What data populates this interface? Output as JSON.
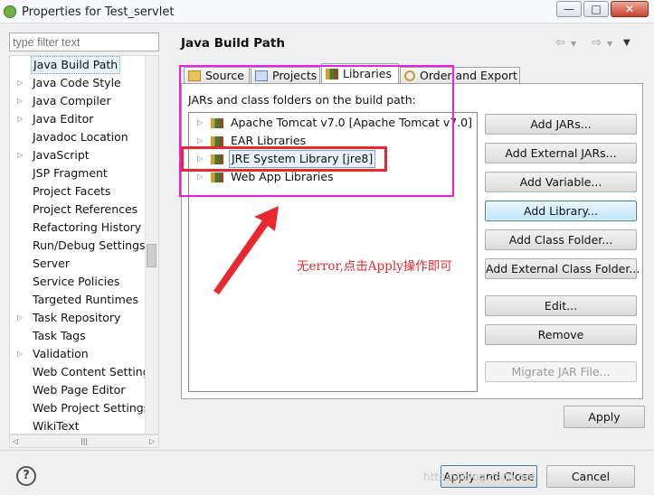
{
  "window": {
    "title": "Properties for Test_servlet",
    "controls": {
      "minimize": "—",
      "maximize": "□",
      "close": "✕"
    }
  },
  "sidebar": {
    "filter_placeholder": "type filter text",
    "items": [
      {
        "label": "Java Build Path",
        "expandable": false,
        "selected": true
      },
      {
        "label": "Java Code Style",
        "expandable": true
      },
      {
        "label": "Java Compiler",
        "expandable": true
      },
      {
        "label": "Java Editor",
        "expandable": true
      },
      {
        "label": "Javadoc Location",
        "expandable": false
      },
      {
        "label": "JavaScript",
        "expandable": true
      },
      {
        "label": "JSP Fragment",
        "expandable": false
      },
      {
        "label": "Project Facets",
        "expandable": false
      },
      {
        "label": "Project References",
        "expandable": false
      },
      {
        "label": "Refactoring History",
        "expandable": false
      },
      {
        "label": "Run/Debug Settings",
        "expandable": false
      },
      {
        "label": "Server",
        "expandable": false
      },
      {
        "label": "Service Policies",
        "expandable": false
      },
      {
        "label": "Targeted Runtimes",
        "expandable": false
      },
      {
        "label": "Task Repository",
        "expandable": true
      },
      {
        "label": "Task Tags",
        "expandable": false
      },
      {
        "label": "Validation",
        "expandable": true
      },
      {
        "label": "Web Content Settings",
        "expandable": false
      },
      {
        "label": "Web Page Editor",
        "expandable": false
      },
      {
        "label": "Web Project Settings",
        "expandable": false
      },
      {
        "label": "WikiText",
        "expandable": false
      }
    ]
  },
  "page": {
    "title": "Java Build Path",
    "tabs": [
      {
        "label": "Source"
      },
      {
        "label": "Projects"
      },
      {
        "label": "Libraries",
        "active": true
      },
      {
        "label": "Order and Export"
      }
    ],
    "section_label": "JARs and class folders on the build path:",
    "libraries": [
      {
        "label": "Apache Tomcat v7.0 [Apache Tomcat v7.0]"
      },
      {
        "label": "EAR Libraries"
      },
      {
        "label": "JRE System Library [jre8]",
        "selected": true
      },
      {
        "label": "Web App Libraries"
      }
    ],
    "buttons": {
      "add_jars": "Add JARs...",
      "add_external_jars": "Add External JARs...",
      "add_variable": "Add Variable...",
      "add_library": "Add Library...",
      "add_class_folder": "Add Class Folder...",
      "add_external_class_folder": "Add External Class Folder...",
      "edit": "Edit...",
      "remove": "Remove",
      "migrate_jar": "Migrate JAR File..."
    },
    "apply": "Apply"
  },
  "footer": {
    "help": "?",
    "apply_and_close": "Apply and Close",
    "cancel": "Cancel",
    "watermark": "https://blog.csdn.net"
  },
  "annotation": {
    "text": "无error,点击Apply操作即可",
    "color_magenta": "#e91ee9",
    "color_red": "#e8282e"
  }
}
